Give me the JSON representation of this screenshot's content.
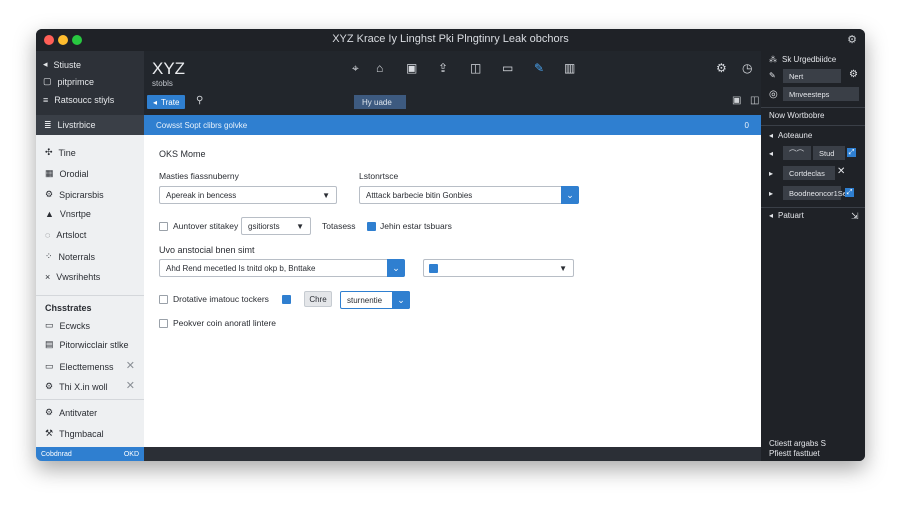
{
  "window": {
    "title": "XYZ Krace Iy Linghst Pki Plngtinry Leak obchors",
    "traffic_lights": [
      "#ff5f57",
      "#febc2e",
      "#28c840"
    ]
  },
  "sidebar": {
    "header_items": [
      {
        "icon": "back-arrow-icon",
        "label": "Stiuste"
      },
      {
        "icon": "square-icon",
        "label": "pitprimce"
      },
      {
        "icon": "bars-icon",
        "label": "Ratsoucc stiyls"
      }
    ],
    "section_title": "Livstrbice",
    "items": [
      {
        "icon": "move-icon",
        "label": "Tine"
      },
      {
        "icon": "grid-icon",
        "label": "Orodial"
      },
      {
        "icon": "gear-icon",
        "label": "Spicrarsbis"
      },
      {
        "icon": "up-icon",
        "label": "Vnsrtpe"
      },
      {
        "icon": "circle-icon",
        "label": "Artsloct"
      },
      {
        "icon": "dots-icon",
        "label": "Noterrals"
      },
      {
        "icon": "x-icon",
        "label": "Vwsrihehts"
      }
    ],
    "group_title": "Chsstrates",
    "group_items": [
      {
        "icon": "screen-icon",
        "label": "Ecwcks",
        "closable": false
      },
      {
        "icon": "doc-icon",
        "label": "Pitorwicclair stlke",
        "closable": false
      },
      {
        "icon": "screen-icon",
        "label": "Electtemenss",
        "closable": true
      },
      {
        "icon": "gear-icon",
        "label": "Thi X.in woll",
        "closable": true
      }
    ],
    "bottom_items": [
      {
        "icon": "gear-icon",
        "label": "Antitvater"
      },
      {
        "icon": "wrench-icon",
        "label": "Thgmbacal"
      }
    ],
    "footer": {
      "left": "Cobdnrad",
      "right": "OKD"
    }
  },
  "header": {
    "brand": "XYZ",
    "brand_sub": "stobls",
    "tab_active": "Trate",
    "tab_secondary": "Hy uade"
  },
  "banner": {
    "text": "Cowsst Sopt clibrs golvke",
    "count": "0"
  },
  "form": {
    "section_title": "OKS Mome",
    "field1_label": "Masties fiassnuberny",
    "field1_value": "Apereak in bencess",
    "field2_label": "Lstonrtsce",
    "field2_value": "Atttack barbecie bitin Gonbies",
    "row3_check_label": "Auntover stitakey",
    "row3_select_value": "gsitiorsts",
    "row3_text": "Totasess",
    "row3_check2_label": "Jehin estar tsbuars",
    "section2_title": "Uvo anstocial bnen simt",
    "field3_value": "Ahd Rend mecetled Is tnitd okp b, Bnttake",
    "row5_check_label": "Drotative imatouc tockers",
    "row5_button": "Chre",
    "row5_input_value": "sturnentie",
    "row6_check_label": "Peokver coin anoratl lintere"
  },
  "right_panel": {
    "top_label": "Sk Urgedbiidce",
    "field1": "Nert",
    "field2": "Mnveesteps",
    "section1": "Now Wortbobre",
    "section2": "Aoteaune",
    "row_a": "Stud",
    "row_b": "Cortdeclas",
    "row_c": "Boodneoncor1Se",
    "section3": "Patuart",
    "footer_line1": "Ctiestt argabs S",
    "footer_line2": "Pfiestt fasttuet"
  }
}
